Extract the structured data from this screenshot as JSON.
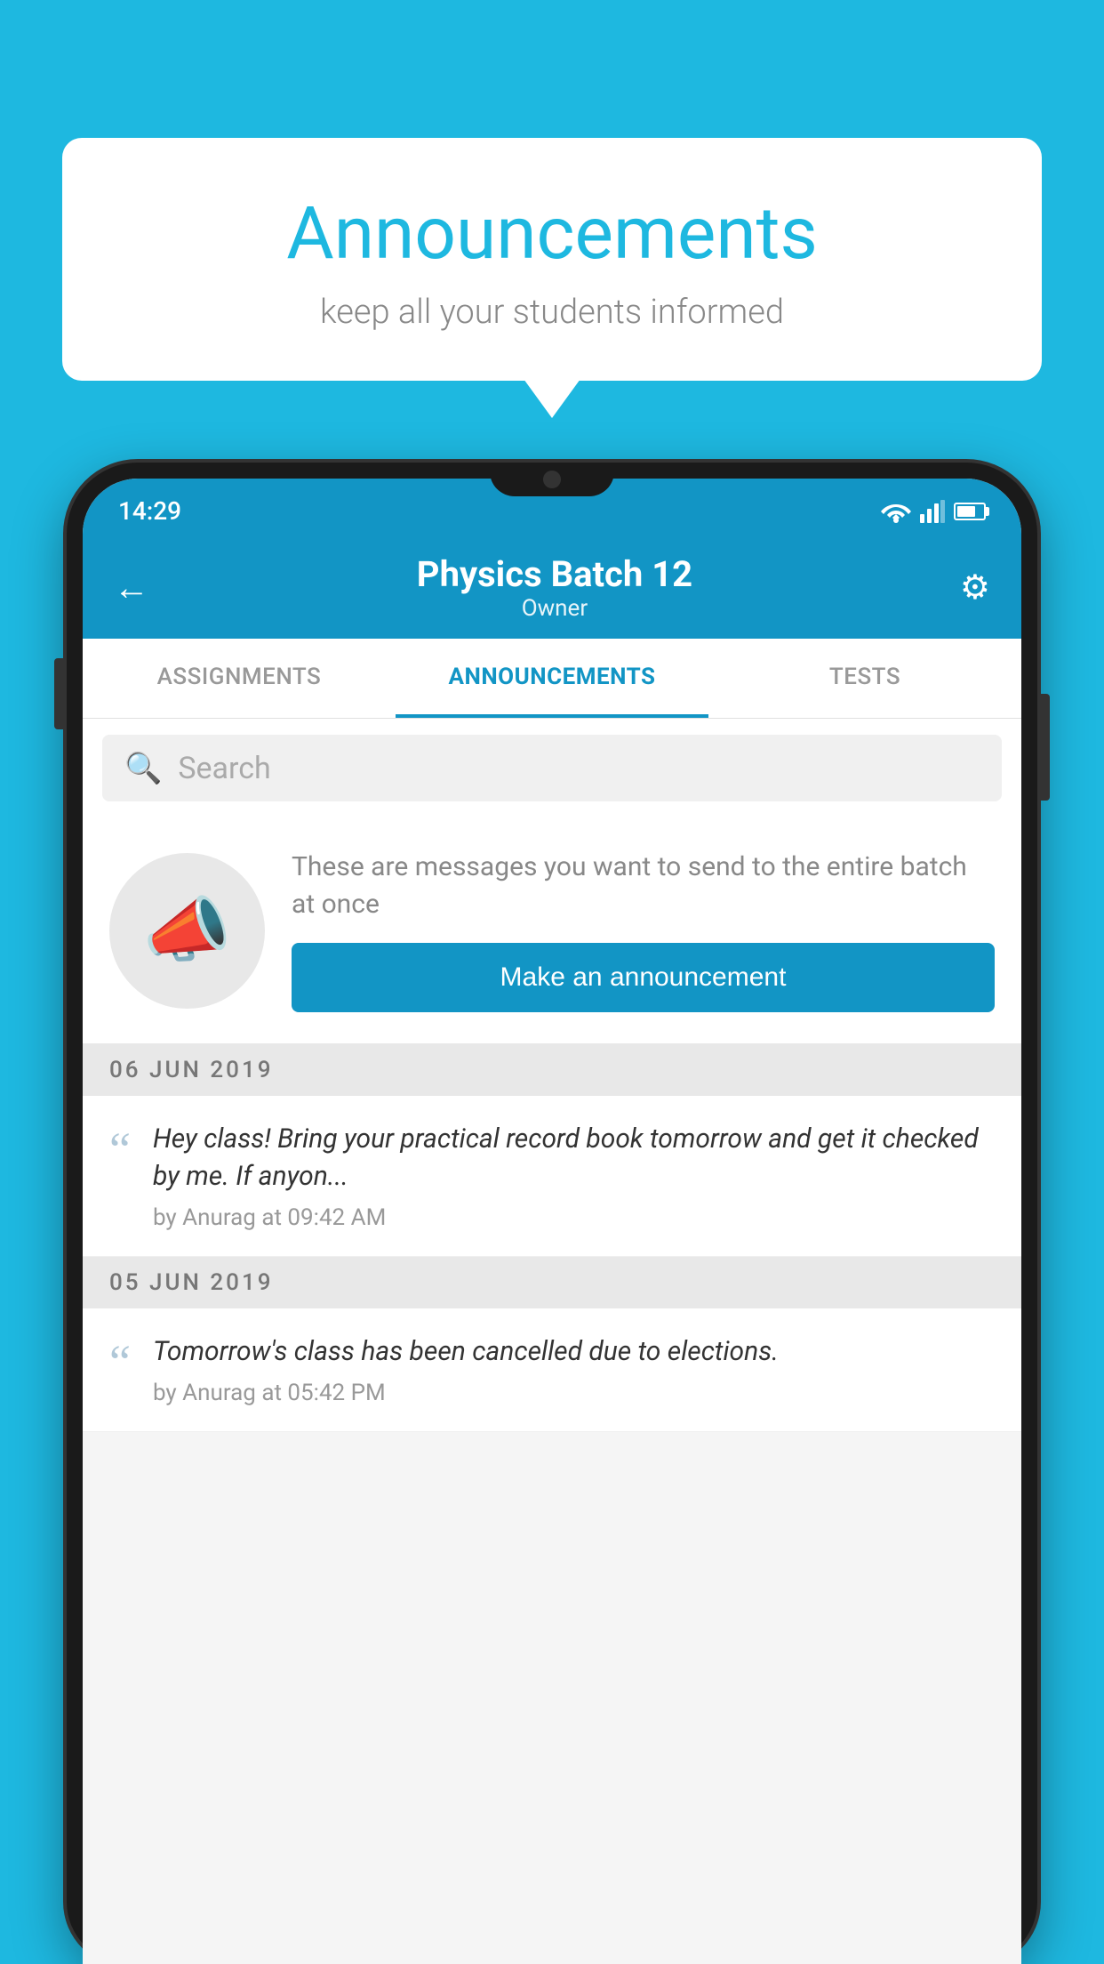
{
  "background_color": "#1eb8e0",
  "speech_bubble": {
    "title": "Announcements",
    "subtitle": "keep all your students informed"
  },
  "phone": {
    "status_bar": {
      "time": "14:29"
    },
    "app_bar": {
      "title": "Physics Batch 12",
      "subtitle": "Owner",
      "back_label": "←",
      "settings_label": "⚙"
    },
    "tabs": [
      {
        "label": "ASSIGNMENTS",
        "active": false
      },
      {
        "label": "ANNOUNCEMENTS",
        "active": true
      },
      {
        "label": "TESTS",
        "active": false
      }
    ],
    "search": {
      "placeholder": "Search"
    },
    "announcement_prompt": {
      "description": "These are messages you want to send to the entire batch at once",
      "button_label": "Make an announcement"
    },
    "announcements": [
      {
        "date": "06  JUN  2019",
        "message": "Hey class! Bring your practical record book tomorrow and get it checked by me. If anyon...",
        "meta": "by Anurag at 09:42 AM"
      },
      {
        "date": "05  JUN  2019",
        "message": "Tomorrow's class has been cancelled due to elections.",
        "meta": "by Anurag at 05:42 PM"
      }
    ]
  }
}
